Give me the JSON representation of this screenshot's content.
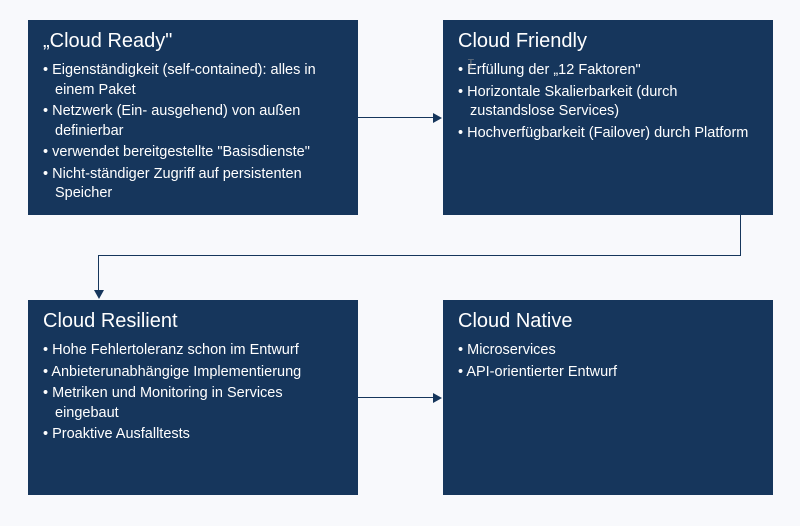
{
  "boxes": {
    "box1": {
      "title": "„Cloud Ready\"",
      "items": [
        "Eigenständigkeit (self-contained): alles in einem Paket",
        "Netzwerk (Ein- ausgehend) von außen definierbar",
        "verwendet bereitgestellte \"Basisdienste\"",
        "Nicht-ständiger Zugriff auf persistenten Speicher"
      ]
    },
    "box2": {
      "title": "Cloud Friendly",
      "items": [
        "Erfüllung der „12 Faktoren\"",
        "Horizontale Skalierbarkeit (durch zustandslose Services)",
        "Hochverfügbarkeit (Failover) durch Platform"
      ]
    },
    "box3": {
      "title": "Cloud Resilient",
      "items": [
        "Hohe Fehlertoleranz schon im Entwurf",
        "Anbieterunabhängige Implementierung",
        "Metriken und Monitoring in Services eingebaut",
        "Proaktive Ausfalltests"
      ]
    },
    "box4": {
      "title": "Cloud Native",
      "items": [
        "Microservices",
        "API-orientierter Entwurf"
      ]
    }
  }
}
